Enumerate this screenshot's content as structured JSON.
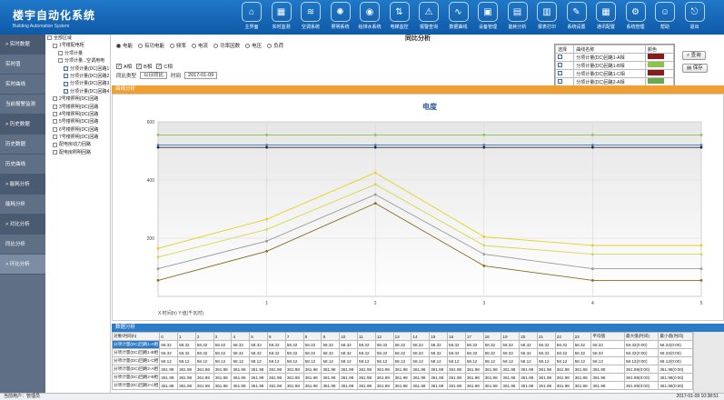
{
  "brand": {
    "title": "楼宇自动化系统",
    "subtitle": "Building Automation System"
  },
  "topnav": [
    {
      "label": "主界面",
      "icon": "home-icon",
      "glyph": "⌂"
    },
    {
      "label": "实时监测",
      "icon": "calendar-icon",
      "glyph": "▦"
    },
    {
      "label": "空调系统",
      "icon": "air-conditioner-icon",
      "glyph": "≋"
    },
    {
      "label": "照明系统",
      "icon": "lightbulb-icon",
      "glyph": "✺"
    },
    {
      "label": "给排水系统",
      "icon": "water-icon",
      "glyph": "◉"
    },
    {
      "label": "电梯监控",
      "icon": "elevator-icon",
      "glyph": "⇅"
    },
    {
      "label": "报警查询",
      "icon": "alarm-icon",
      "glyph": "⚠"
    },
    {
      "label": "数据曲线",
      "icon": "curve-icon",
      "glyph": "∿"
    },
    {
      "label": "设备管理",
      "icon": "monitor-icon",
      "glyph": "▣"
    },
    {
      "label": "能耗分析",
      "icon": "folder-icon",
      "glyph": "▤"
    },
    {
      "label": "报表打印",
      "icon": "print-icon",
      "glyph": "▥"
    },
    {
      "label": "系统设置",
      "icon": "settings-icon",
      "glyph": "✎"
    },
    {
      "label": "通讯配置",
      "icon": "grid-icon",
      "glyph": "▦"
    },
    {
      "label": "系统管理",
      "icon": "gear-icon",
      "glyph": "⚙"
    },
    {
      "label": "帮助",
      "icon": "user-icon",
      "glyph": "☺"
    },
    {
      "label": "退出",
      "icon": "exit-icon",
      "glyph": "⎋"
    }
  ],
  "leftnav": [
    {
      "label": "> 实时数据",
      "type": "sec"
    },
    {
      "label": "实时值",
      "type": "item"
    },
    {
      "label": "实时曲线",
      "type": "item"
    },
    {
      "label": "当前报警监测",
      "type": "item"
    },
    {
      "label": "> 历史数据",
      "type": "sec"
    },
    {
      "label": "历史数据",
      "type": "item"
    },
    {
      "label": "历史曲线",
      "type": "item"
    },
    {
      "label": "> 能耗分析",
      "type": "sec"
    },
    {
      "label": "能耗分析",
      "type": "item"
    },
    {
      "label": "> 对比分析",
      "type": "sec"
    },
    {
      "label": "同比分析",
      "type": "item"
    },
    {
      "label": "> 环比分析",
      "type": "active"
    }
  ],
  "tree": [
    {
      "label": "全部区域",
      "indent": 0,
      "kind": "box"
    },
    {
      "label": "1号楼配电柜",
      "indent": 1,
      "kind": "box"
    },
    {
      "label": "分项计量",
      "indent": 2,
      "kind": "box"
    },
    {
      "label": "分项计量...空调用电",
      "indent": 2,
      "kind": "box"
    },
    {
      "label": "分项计量(DC)回路1",
      "indent": 3,
      "kind": "chk"
    },
    {
      "label": "分项计量(DC)回路2",
      "indent": 3,
      "kind": "chk"
    },
    {
      "label": "分项计量(DC)回路3",
      "indent": 3,
      "kind": "chk"
    },
    {
      "label": "分项计量(DC)回路4",
      "indent": 3,
      "kind": "chk"
    },
    {
      "label": "2号楼照明(DC)回路",
      "indent": 1,
      "kind": "box"
    },
    {
      "label": "3号楼照明(DC)回路",
      "indent": 1,
      "kind": "box"
    },
    {
      "label": "4号楼照明(DC)回路",
      "indent": 1,
      "kind": "box"
    },
    {
      "label": "5号楼照明(DC)回路",
      "indent": 1,
      "kind": "box"
    },
    {
      "label": "6号楼照明(DC)回路",
      "indent": 1,
      "kind": "box"
    },
    {
      "label": "7号楼照明(DC)回路",
      "indent": 1,
      "kind": "box"
    },
    {
      "label": "配电房动力回路",
      "indent": 1,
      "kind": "box"
    },
    {
      "label": "配电房照明回路",
      "indent": 1,
      "kind": "box"
    }
  ],
  "page": {
    "title": "同比分析"
  },
  "radios": [
    {
      "label": "电能",
      "on": true
    },
    {
      "label": "有功电能",
      "on": false
    },
    {
      "label": "频率",
      "on": false
    },
    {
      "label": "电流",
      "on": false
    },
    {
      "label": "功率因数",
      "on": false
    },
    {
      "label": "电压",
      "on": false
    },
    {
      "label": "负荷",
      "on": false
    }
  ],
  "checks": [
    {
      "label": "A相",
      "on": true
    },
    {
      "label": "B相",
      "on": true
    },
    {
      "label": "C相",
      "on": true
    }
  ],
  "query": {
    "type_label": "同比类型",
    "type_value": "以日同比",
    "time_label": "时间",
    "time_value": "2017-01-09"
  },
  "objects": {
    "header": [
      "选择",
      "曲线名称",
      "颜色"
    ],
    "rows": [
      {
        "name": "分项计量(DC)回路1-A相",
        "color": "#8b1a1a"
      },
      {
        "name": "分项计量(DC)回路1-B相",
        "color": "#8bc34a"
      },
      {
        "name": "分项计量(DC)回路1-C相",
        "color": "#8b1a1a"
      },
      {
        "name": "分项计量(DC)回路2-A相",
        "color": "#6aa84f"
      }
    ]
  },
  "buttons": {
    "query": "查询",
    "save": "保存"
  },
  "sections": {
    "chart": "曲线分析",
    "table": "数据分析"
  },
  "chart_data": {
    "type": "line",
    "title": "电度",
    "x": [
      0,
      1,
      2,
      3,
      4,
      5
    ],
    "ylim": [
      0,
      600
    ],
    "yticks": [
      200,
      400,
      600
    ],
    "xticks": [
      "1",
      "2",
      "3",
      "4",
      "5"
    ],
    "xlabel": "X:时间(h)  Y:值(千瓦时)",
    "series": [
      {
        "color": "#8bc34a",
        "values": [
          555,
          555,
          555,
          555,
          555,
          555
        ]
      },
      {
        "color": "#3a78c4",
        "values": [
          520,
          520,
          520,
          520,
          520,
          520
        ]
      },
      {
        "color": "#2a2a2a",
        "values": [
          512,
          512,
          512,
          512,
          512,
          512
        ]
      },
      {
        "color": "#e6d11c",
        "values": [
          165,
          265,
          425,
          205,
          175,
          175
        ]
      },
      {
        "color": "#d9d64a",
        "values": [
          135,
          230,
          385,
          175,
          145,
          145
        ]
      },
      {
        "color": "#9a9a9a",
        "values": [
          95,
          190,
          350,
          145,
          95,
          95
        ]
      },
      {
        "color": "#8a6a22",
        "values": [
          55,
          155,
          320,
          105,
          55,
          55
        ]
      }
    ]
  },
  "table": {
    "header": [
      "对象\\时间(h)",
      "0",
      "1",
      "2",
      "3",
      "4",
      "5",
      "6",
      "7",
      "8",
      "9",
      "10",
      "11",
      "12",
      "13",
      "14",
      "15",
      "16",
      "17",
      "18",
      "19",
      "20",
      "21",
      "22",
      "23",
      "平均值",
      "最大值(时间)",
      "最小值(时间)"
    ],
    "rows": [
      {
        "name": "分项计量(DC)回路1-A相",
        "cells": [
          "68.32",
          "58.32",
          "58.32",
          "58.32",
          "58.32",
          "58.32",
          "58.32",
          "58.32",
          "58.32",
          "58.32",
          "58.32",
          "58.32",
          "58.32",
          "58.32",
          "58.32",
          "58.32",
          "58.32",
          "58.32",
          "58.32",
          "58.32",
          "58.32",
          "58.32",
          "58.32",
          "58.32",
          "58.32",
          "58.32(0:00)",
          "58.32(0:00)"
        ],
        "highlight": true
      },
      {
        "name": "分项计量(DC)回路1-B相",
        "cells": [
          "58.32",
          "58.32",
          "58.32",
          "58.32",
          "58.32",
          "58.32",
          "58.32",
          "58.32",
          "58.32",
          "58.32",
          "58.32",
          "58.32",
          "58.32",
          "58.32",
          "58.32",
          "58.32",
          "58.32",
          "58.32",
          "58.32",
          "58.32",
          "58.32",
          "58.32",
          "58.32",
          "58.32",
          "58.32",
          "58.32(0:00)",
          "58.32(0:00)"
        ],
        "highlight": false
      },
      {
        "name": "分项计量(DC)回路1-C相",
        "cells": [
          "58.12",
          "58.12",
          "58.12",
          "58.12",
          "58.12",
          "58.12",
          "58.12",
          "58.12",
          "58.12",
          "58.12",
          "58.12",
          "58.12",
          "58.12",
          "58.12",
          "58.12",
          "58.12",
          "58.12",
          "58.12",
          "58.12",
          "58.12",
          "58.12",
          "58.12",
          "58.12",
          "58.12",
          "58.12",
          "58.12(0:00)",
          "58.12(0:00)"
        ],
        "highlight": false
      },
      {
        "name": "分项计量(DC)回路2-A相",
        "cells": [
          "361.98",
          "361.98",
          "361.98",
          "361.98",
          "361.98",
          "361.98",
          "361.98",
          "361.98",
          "361.98",
          "361.98",
          "361.98",
          "361.98",
          "361.98",
          "361.98",
          "361.98",
          "361.98",
          "361.98",
          "361.98",
          "361.98",
          "361.98",
          "361.98",
          "361.98",
          "361.98",
          "361.98",
          "361.98",
          "361.98(0:00)",
          "361.98(0:00)"
        ],
        "highlight": false
      },
      {
        "name": "分项计量(DC)回路2-B相",
        "cells": [
          "361.98",
          "361.98",
          "361.98",
          "361.98",
          "361.98",
          "361.98",
          "361.98",
          "361.98",
          "361.98",
          "361.98",
          "361.98",
          "361.98",
          "361.98",
          "361.98",
          "361.98",
          "361.98",
          "361.98",
          "361.98",
          "361.98",
          "361.98",
          "361.98",
          "361.98",
          "361.98",
          "361.98",
          "361.98",
          "361.98(0:00)",
          "361.98(0:00)"
        ],
        "highlight": false
      },
      {
        "name": "分项计量(DC)回路2-C相",
        "cells": [
          "361.98",
          "361.98",
          "361.98",
          "361.98",
          "361.98",
          "361.98",
          "361.98",
          "361.98",
          "361.98",
          "361.98",
          "361.98",
          "361.98",
          "361.98",
          "361.98",
          "361.98",
          "361.98",
          "361.98",
          "361.98",
          "361.98",
          "361.98",
          "361.98",
          "361.98",
          "361.98",
          "361.98",
          "361.98",
          "361.98(0:00)",
          "361.98(0:00)"
        ],
        "highlight": false
      }
    ]
  },
  "status": {
    "left": "当前用户：管理员",
    "right": "2017-01-09 10:38:51"
  }
}
